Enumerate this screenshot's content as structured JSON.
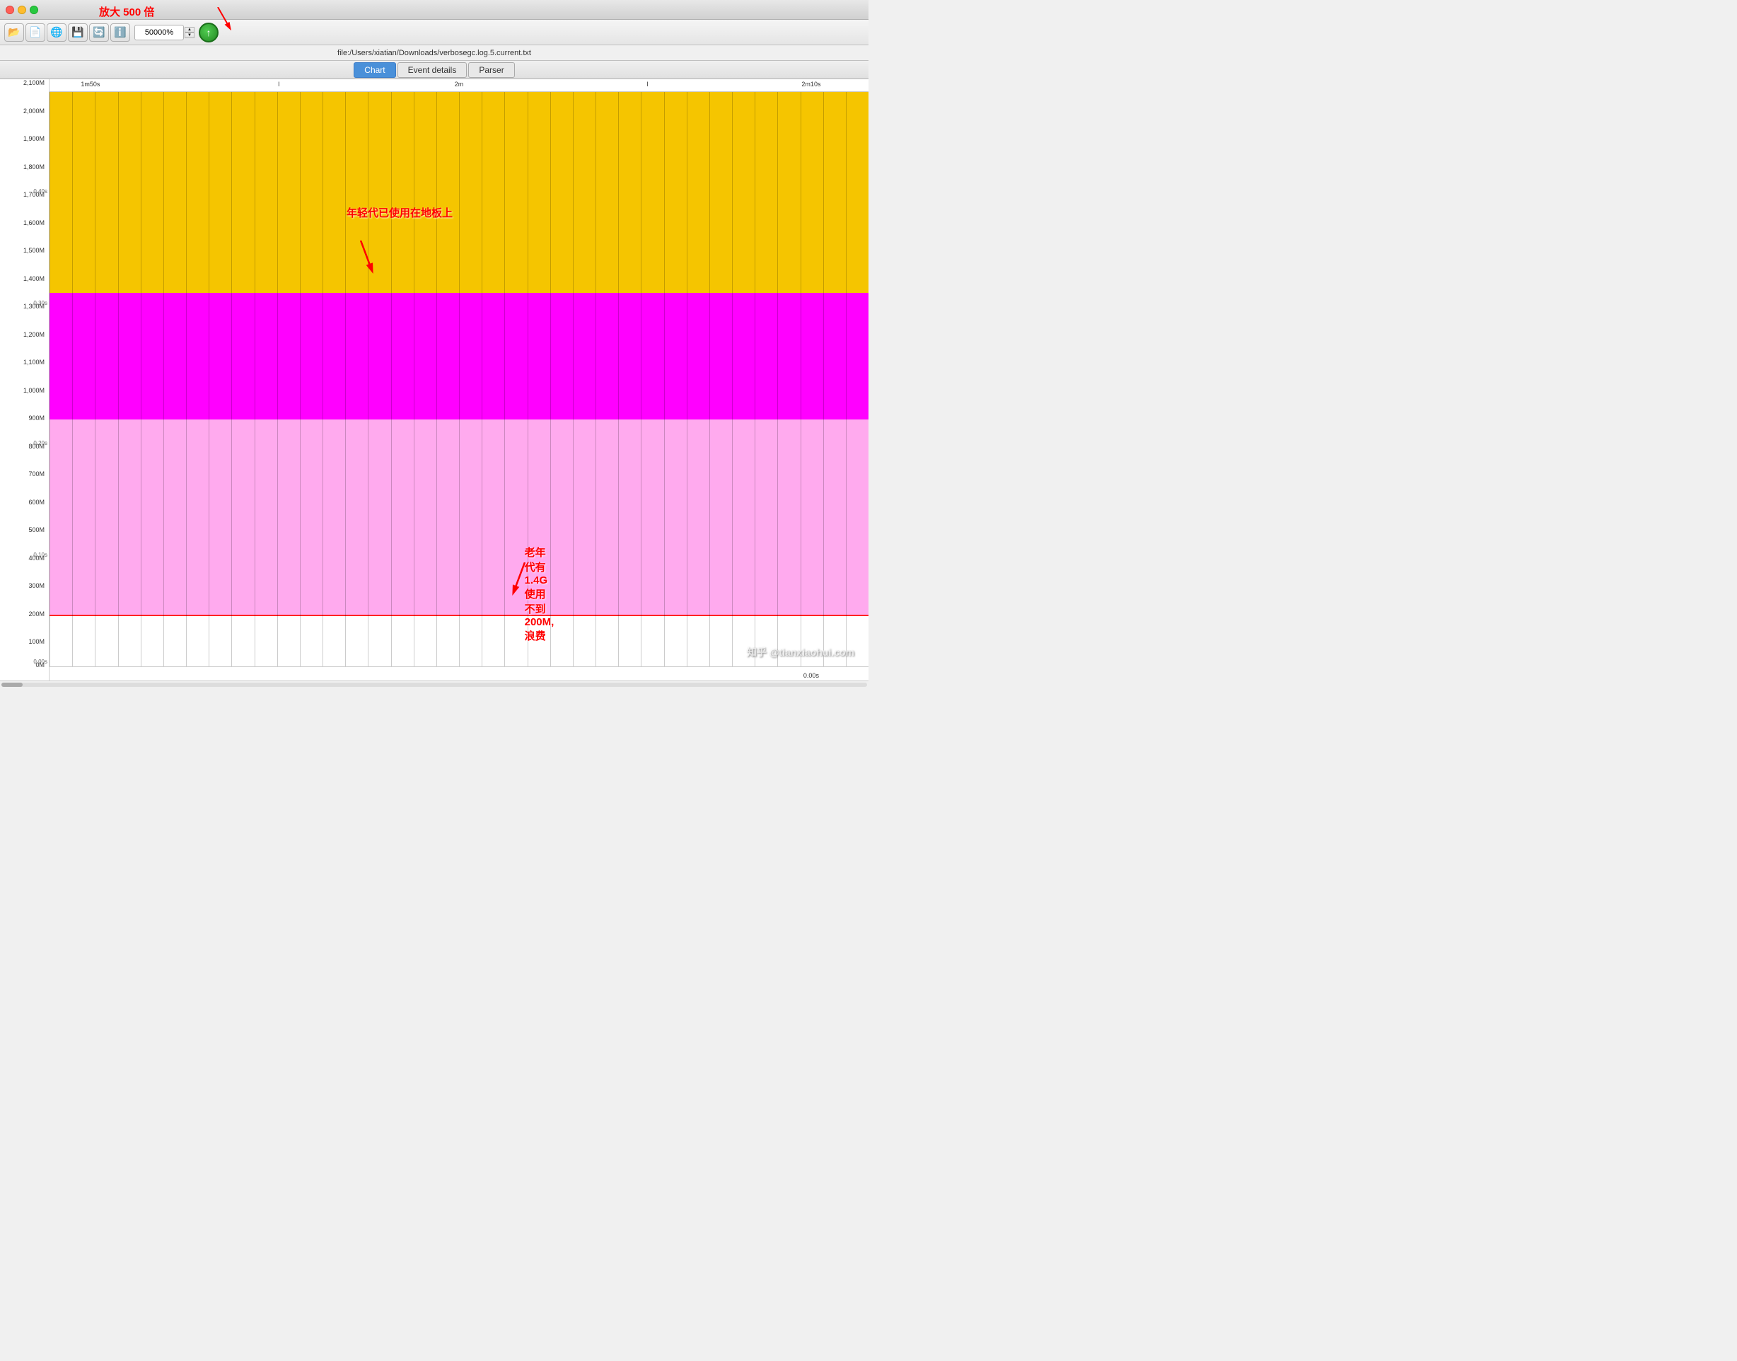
{
  "window": {
    "title": "verbosegc.log.5.current.txt",
    "file_path": "file:/Users/xiatian/Downloads/verbosegc.log.5.current.txt"
  },
  "toolbar": {
    "zoom_value": "50000%",
    "buttons": [
      "folder-open",
      "file-new",
      "globe",
      "save",
      "refresh",
      "info"
    ]
  },
  "tabs": [
    {
      "id": "chart",
      "label": "Chart",
      "active": true
    },
    {
      "id": "event-details",
      "label": "Event details",
      "active": false
    },
    {
      "id": "parser",
      "label": "Parser",
      "active": false
    }
  ],
  "annotations": {
    "zoom_label": "放大 500 倍",
    "young_gen_label": "年轻代已使用在地板上",
    "old_gen_label": "老年代有 1.4G 使用不到 200M, 浪费"
  },
  "chart": {
    "time_labels": [
      "1m50s",
      "l",
      "2m",
      "l",
      "2m10s"
    ],
    "y_labels": [
      "2,100M",
      "2,000M",
      "1,900M",
      "1,800M",
      "1,700M",
      "1,600M",
      "1,500M",
      "1,400M",
      "1,300M",
      "1,200M",
      "1,100M",
      "1,000M",
      "900M",
      "800M",
      "700M",
      "600M",
      "500M",
      "400M",
      "300M",
      "200M",
      "100M",
      "0M"
    ],
    "time_secondary_labels": [
      {
        "value": "0.40s",
        "position": 0.26
      },
      {
        "value": "0.30s",
        "position": 0.44
      },
      {
        "value": "0.20s",
        "position": 0.62
      },
      {
        "value": "0.10s",
        "position": 0.79
      },
      {
        "value": "0.00s",
        "position": 1.0
      }
    ],
    "regions": {
      "yellow_top_pct": 0,
      "yellow_bottom_pct": 35,
      "magenta_top_pct": 35,
      "magenta_bottom_pct": 57,
      "light_pink_top_pct": 57,
      "light_pink_bottom_pct": 91
    },
    "red_line_pct": 91,
    "grid_lines_count": 35
  },
  "watermark": "知乎 @tianxiaohui.com"
}
